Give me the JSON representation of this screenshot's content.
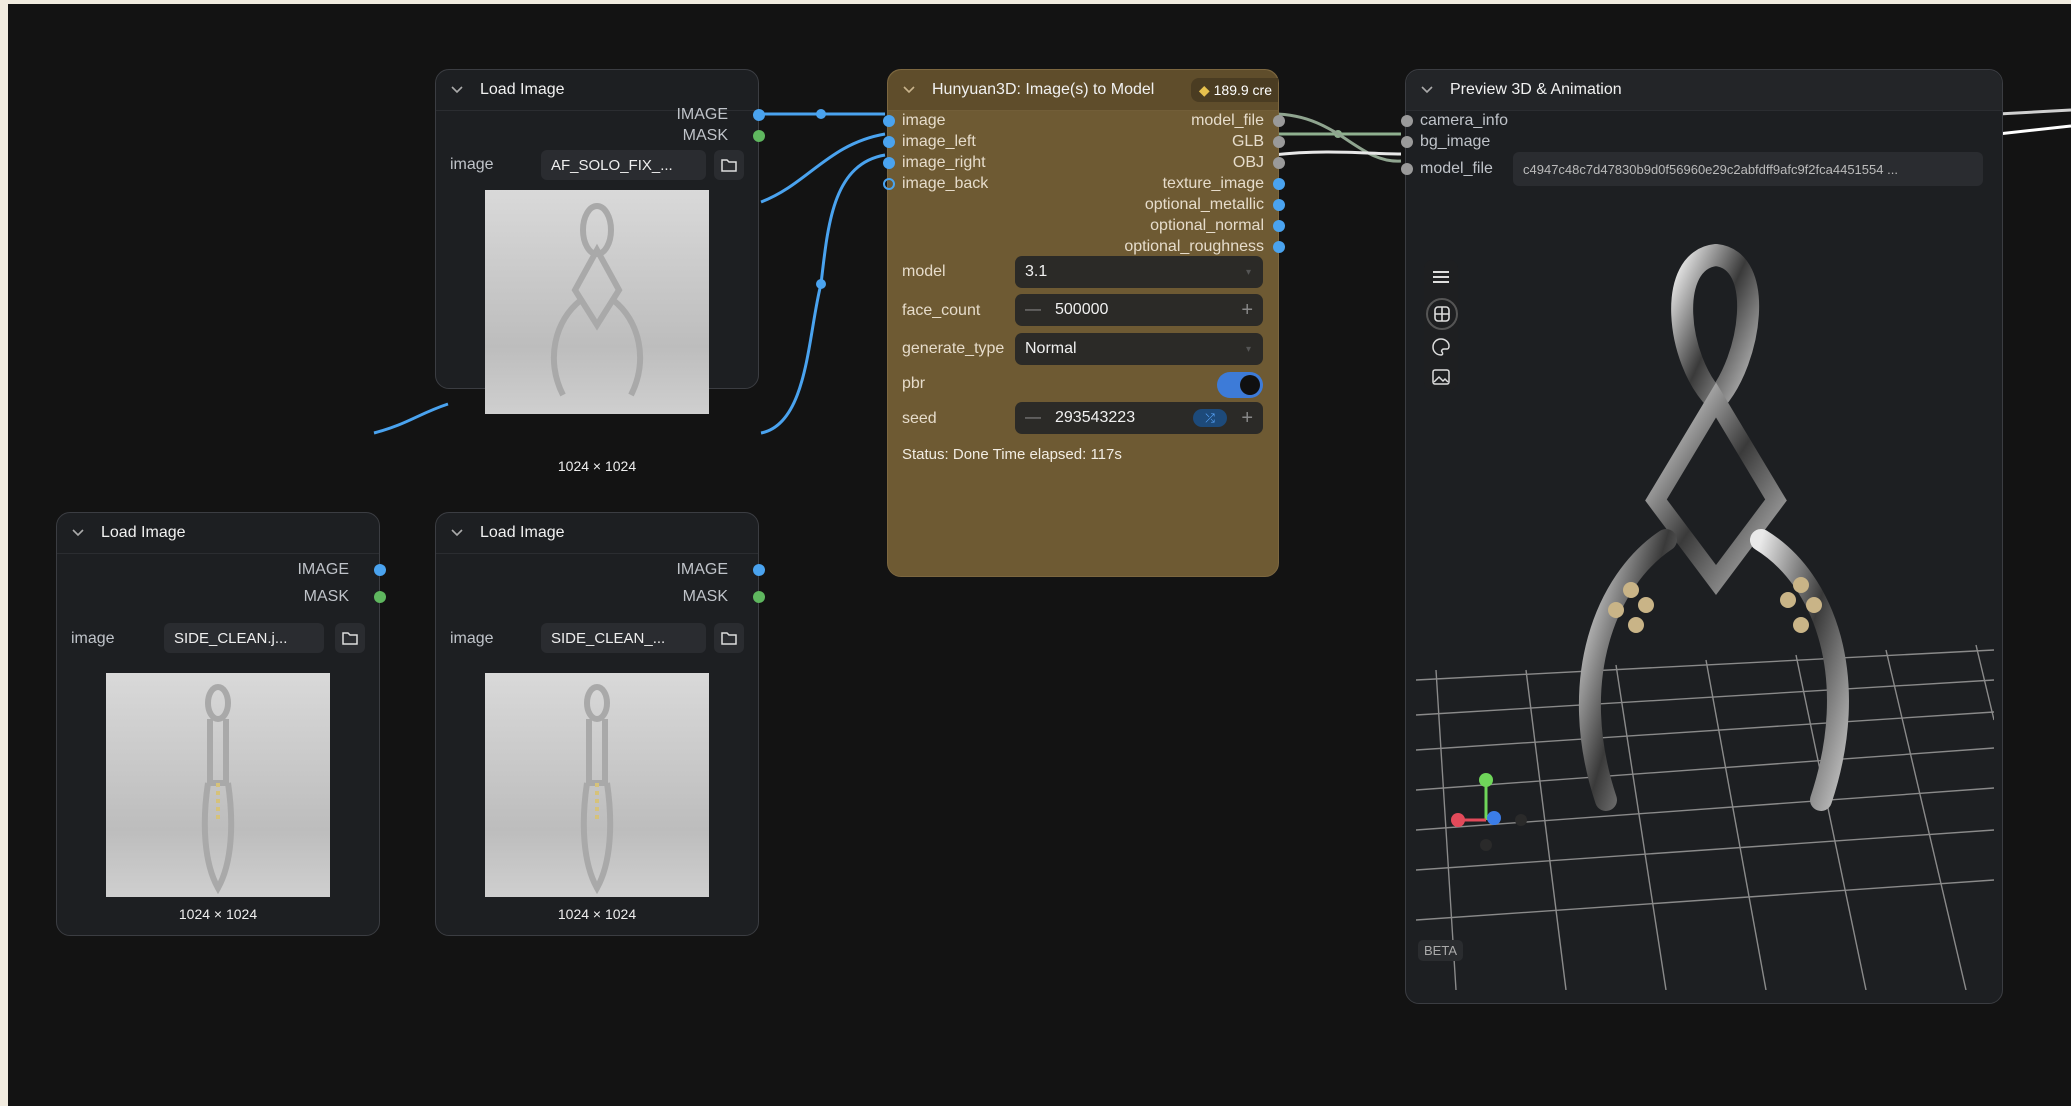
{
  "colors": {
    "canvas_bg": "#131313",
    "link_blue": "#4aa3ef",
    "link_grey": "#bcbcbc",
    "accent_toggle": "#3d7bd8",
    "hunyuan_node": "#6e5a33"
  },
  "load_image_1": {
    "title": "Load Image",
    "output_image": "IMAGE",
    "output_mask": "MASK",
    "widget_label": "image",
    "filename": "AF_SOLO_FIX_...",
    "dimensions": "1024 × 1024"
  },
  "load_image_2": {
    "title": "Load Image",
    "output_image": "IMAGE",
    "output_mask": "MASK",
    "widget_label": "image",
    "filename": "SIDE_CLEAN.j...",
    "dimensions": "1024 × 1024"
  },
  "load_image_3": {
    "title": "Load Image",
    "output_image": "IMAGE",
    "output_mask": "MASK",
    "widget_label": "image",
    "filename": "SIDE_CLEAN_...",
    "dimensions": "1024 × 1024"
  },
  "hunyuan": {
    "title": "Hunyuan3D: Image(s) to Model",
    "credits": "189.9 cre",
    "inputs": [
      "image",
      "image_left",
      "image_right",
      "image_back"
    ],
    "outputs": [
      "model_file",
      "GLB",
      "OBJ",
      "texture_image",
      "optional_metallic",
      "optional_normal",
      "optional_roughness"
    ],
    "model_label": "model",
    "model_value": "3.1",
    "face_count_label": "face_count",
    "face_count_value": "500000",
    "generate_type_label": "generate_type",
    "generate_type_value": "Normal",
    "pbr_label": "pbr",
    "pbr_enabled": true,
    "seed_label": "seed",
    "seed_value": "293543223",
    "status": "Status: Done Time elapsed: 117s"
  },
  "preview": {
    "title": "Preview 3D & Animation",
    "inputs": [
      "camera_info",
      "bg_image",
      "model_file"
    ],
    "model_file_value": "c4947c48c7d47830b9d0f56960e29c2abfdff9afc9f2fca4451554 ...",
    "toolbar_icons": [
      "menu-icon",
      "grid-icon",
      "palette-icon",
      "image-icon"
    ],
    "badge": "BETA"
  }
}
